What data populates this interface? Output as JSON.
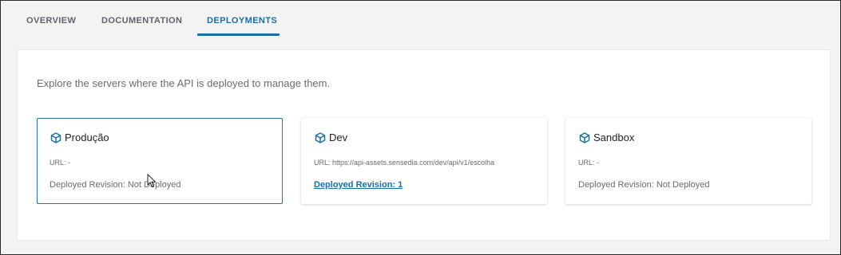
{
  "tabs": [
    {
      "label": "OVERVIEW",
      "active": false
    },
    {
      "label": "DOCUMENTATION",
      "active": false
    },
    {
      "label": "DEPLOYMENTS",
      "active": true
    }
  ],
  "intro_text": "Explore the servers where the API is deployed to manage them.",
  "cards": [
    {
      "title": "Produção",
      "icon": "cube-icon",
      "url": "URL: -",
      "revision": "Deployed Revision: Not Deployed",
      "selected": true
    },
    {
      "title": "Dev",
      "icon": "cube-icon",
      "url": "URL: https://api-assets.sensedia.com/dev/api/v1/escolha",
      "revision": "Deployed Revision: 1",
      "revision_is_link": true
    },
    {
      "title": "Sandbox",
      "icon": "cube-icon",
      "url": "URL: -",
      "revision": "Deployed Revision: Not Deployed"
    }
  ],
  "colors": {
    "accent": "#1a6fa8",
    "selected_border": "#2f6f91",
    "muted_text": "#6b6b6b",
    "background": "#f3f3f3"
  }
}
